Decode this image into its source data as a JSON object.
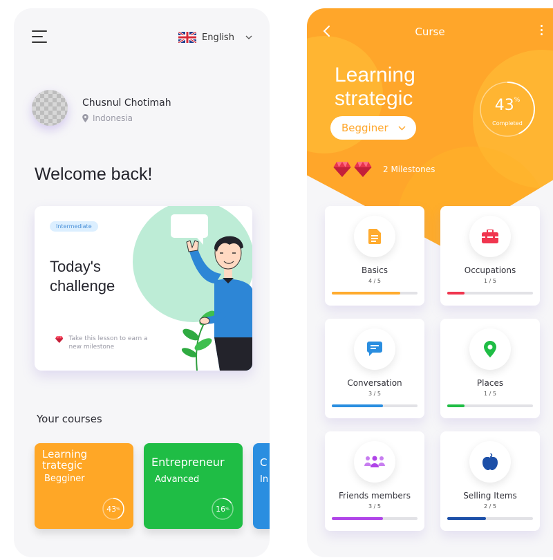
{
  "left": {
    "language": {
      "label": "English"
    },
    "user": {
      "name": "Chusnul Chotimah",
      "location": "Indonesia"
    },
    "welcome": "Welcome back!",
    "challenge": {
      "badge": "Intermediate",
      "title": "Today's challenge",
      "note": "Take this lesson to earn a new milestone"
    },
    "courses_title": "Your courses",
    "courses": [
      {
        "title": "Learning trategic",
        "level": "Begginer",
        "progress_label": "43",
        "progress_unit": "%",
        "progress": 43,
        "color": "#ffa726"
      },
      {
        "title": "Entrepreneur",
        "level": "Advanced",
        "progress_label": "16",
        "progress_unit": "%",
        "progress": 16,
        "color": "#1fbd45"
      },
      {
        "title": "C",
        "level": "In",
        "color": "#2a8ee0"
      }
    ]
  },
  "right": {
    "header_title": "Curse",
    "hero_title": "Learning strategic",
    "level_select": "Begginer",
    "progress": {
      "value": "43",
      "unit": "%",
      "label": "Completed",
      "fraction": 0.43
    },
    "milestones_label": "2 Milestones",
    "topics": [
      {
        "name": "Basics",
        "count": "4 / 5",
        "progress": 0.8,
        "color": "#ffab2e",
        "icon": "document-icon"
      },
      {
        "name": "Occupations",
        "count": "1 / 5",
        "progress": 0.2,
        "color": "#f0364f",
        "icon": "briefcase-icon"
      },
      {
        "name": "Conversation",
        "count": "3 / 5",
        "progress": 0.6,
        "color": "#2a8ee0",
        "icon": "chat-icon"
      },
      {
        "name": "Places",
        "count": "1 / 5",
        "progress": 0.2,
        "color": "#1fbd45",
        "icon": "location-pin-icon"
      },
      {
        "name": "Friends members",
        "count": "3 / 5",
        "progress": 0.6,
        "color": "#b044e8",
        "icon": "people-icon"
      },
      {
        "name": "Selling Items",
        "count": "2 / 5",
        "progress": 0.45,
        "color": "#1c4fa8",
        "icon": "apple-icon"
      }
    ]
  },
  "colors": {
    "accent_orange": "#ffa62a",
    "green": "#1fbd45",
    "blue": "#2a8ee0",
    "ruby": "#e8344d"
  }
}
